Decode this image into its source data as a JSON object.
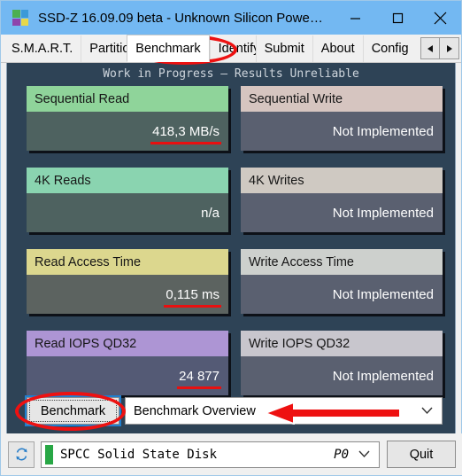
{
  "window": {
    "title": "SSD-Z 16.09.09 beta - Unknown Silicon Powe…",
    "icon": "app-logo-icon",
    "minimize": "minimize-icon",
    "maximize": "maximize-icon",
    "close": "close-icon"
  },
  "tabs": {
    "items": [
      {
        "label": "S.M.A.R.T.",
        "selected": false
      },
      {
        "label": "Partitions",
        "selected": false
      },
      {
        "label": "Benchmark",
        "selected": true
      },
      {
        "label": "Identify",
        "selected": false
      },
      {
        "label": "Submit",
        "selected": false
      },
      {
        "label": "About",
        "selected": false
      },
      {
        "label": "Config",
        "selected": false
      }
    ],
    "scroll_left": "◄",
    "scroll_right": "►"
  },
  "main": {
    "notice": "Work in Progress – Results Unreliable",
    "panels": [
      {
        "title": "Sequential Read",
        "value": "418,3 MB/s",
        "underlined": true,
        "head_color": "#8fd49a",
        "body_color": "#4e6260"
      },
      {
        "title": "Sequential Write",
        "value": "Not Implemented",
        "underlined": false,
        "head_color": "#d6c5c0",
        "body_color": "#5a6070"
      },
      {
        "title": "4K Reads",
        "value": "n/a",
        "underlined": false,
        "head_color": "#8ad4b0",
        "body_color": "#4e6260"
      },
      {
        "title": "4K Writes",
        "value": "Not Implemented",
        "underlined": false,
        "head_color": "#cfc9c2",
        "body_color": "#5a6070"
      },
      {
        "title": "Read Access Time",
        "value": "0,115 ms",
        "underlined": true,
        "head_color": "#dcd78e",
        "body_color": "#5c6360"
      },
      {
        "title": "Write Access Time",
        "value": "Not Implemented",
        "underlined": false,
        "head_color": "#cdd0cd",
        "body_color": "#5a6070"
      },
      {
        "title": "Read IOPS QD32",
        "value": "24 877",
        "underlined": true,
        "head_color": "#ad95d4",
        "body_color": "#545a75"
      },
      {
        "title": "Write IOPS QD32",
        "value": "Not Implemented",
        "underlined": false,
        "head_color": "#c8c6cd",
        "body_color": "#5a6070"
      }
    ],
    "benchmark_button": "Benchmark",
    "overview_select": {
      "value": "Benchmark Overview",
      "chevron": "chevron-down-icon"
    }
  },
  "statusbar": {
    "refresh_icon": "refresh-icon",
    "drive_name": "SPCC Solid State Disk",
    "drive_port": "P0",
    "drive_chevron": "chevron-down-icon",
    "quit_label": "Quit"
  },
  "annotations": {
    "accent_color": "#ee1111",
    "tab_highlight": "benchmark-tab-circle",
    "button_highlight": "benchmark-button-circle",
    "arrow": "overview-dropdown-arrow"
  }
}
